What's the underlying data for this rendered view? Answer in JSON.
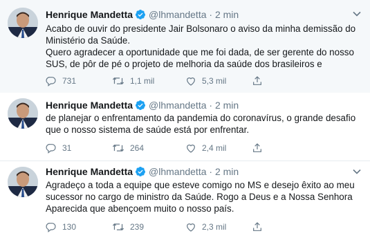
{
  "tweets": [
    {
      "name": "Henrique Mandetta",
      "handle": "@lhmandetta",
      "separator": "·",
      "time": "2 min",
      "text": "Acabo de ouvir do presidente Jair Bolsonaro o aviso da minha demissão do\nMinistério da Saúde.\nQuero agradecer a oportunidade que me foi dada, de ser gerente do nosso\nSUS, de pôr de pé o projeto de melhoria da saúde dos brasileiros e",
      "replies": "731",
      "retweets": "1,1 mil",
      "likes": "5,3 mil"
    },
    {
      "name": "Henrique Mandetta",
      "handle": "@lhmandetta",
      "separator": "·",
      "time": "2 min",
      "text": "de planejar o enfrentamento da pandemia do coronavírus, o grande desafio\nque o nosso sistema de saúde está por enfrentar.",
      "replies": "31",
      "retweets": "264",
      "likes": "2,4 mil"
    },
    {
      "name": "Henrique Mandetta",
      "handle": "@lhmandetta",
      "separator": "·",
      "time": "2 min",
      "text": "Agradeço a toda a equipe que esteve comigo no MS e desejo êxito ao meu\nsucessor no cargo de ministro da Saúde. Rogo a Deus e a Nossa Senhora\nAparecida que abençoem muito o nosso país.",
      "replies": "130",
      "retweets": "239",
      "likes": "2,3 mil"
    }
  ],
  "icons": {
    "verified": "verified-badge-icon",
    "reply": "reply-icon",
    "retweet": "retweet-icon",
    "like": "heart-icon",
    "share": "share-icon",
    "caret": "chevron-down-icon"
  },
  "colors": {
    "verified_blue": "#1da1f2",
    "secondary_text": "#657786",
    "thread_line": "#ccd6dd",
    "highlight_bg": "#f5f8fa"
  }
}
